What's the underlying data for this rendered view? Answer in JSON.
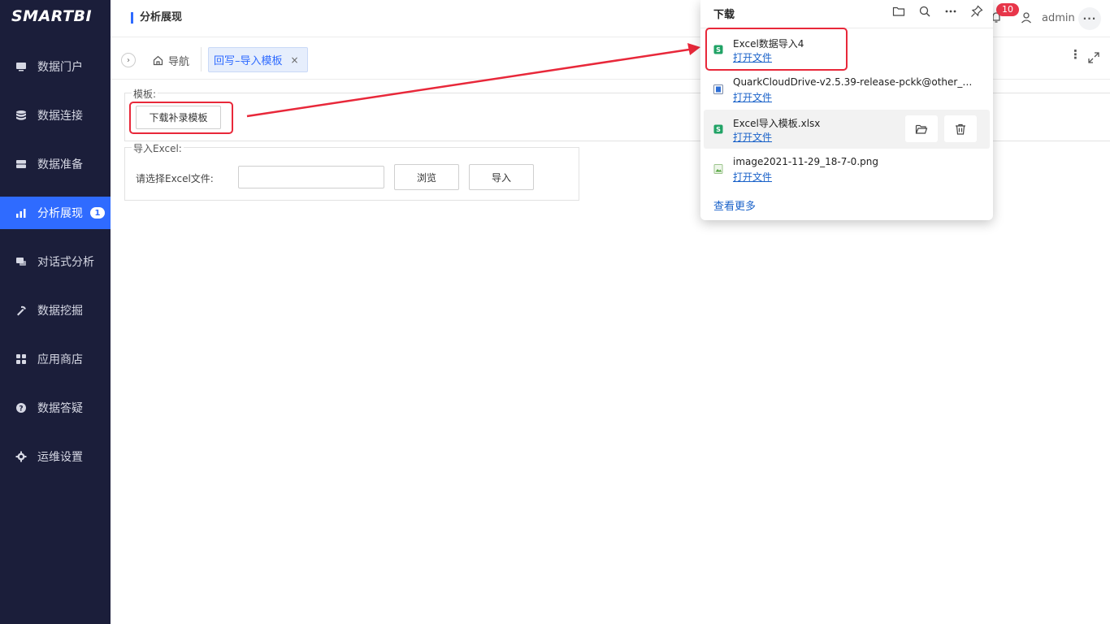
{
  "app": {
    "logo": "SMARTBI"
  },
  "sidebar": {
    "items": [
      {
        "label": "数据门户",
        "icon": "monitor-icon"
      },
      {
        "label": "数据连接",
        "icon": "database-icon"
      },
      {
        "label": "数据准备",
        "icon": "server-icon"
      },
      {
        "label": "分析展现",
        "icon": "bar-chart-icon",
        "badge": "1",
        "active": true
      },
      {
        "label": "对话式分析",
        "icon": "chat-icon"
      },
      {
        "label": "数据挖掘",
        "icon": "pickaxe-icon"
      },
      {
        "label": "应用商店",
        "icon": "grid-icon"
      },
      {
        "label": "数据答疑",
        "icon": "question-icon"
      },
      {
        "label": "运维设置",
        "icon": "gear-icon"
      }
    ]
  },
  "header": {
    "title": "分析展现",
    "notification_count": "10",
    "username": "admin",
    "more": "···"
  },
  "tabs": {
    "collapse": "›",
    "home_label": "导航",
    "active_label": "回写–导入模板",
    "close": "×",
    "dots": "⋮"
  },
  "template_section": {
    "legend": "模板:",
    "download_button": "下载补录模板"
  },
  "import_section": {
    "legend": "导入Excel:",
    "file_label": "请选择Excel文件:",
    "file_value": "",
    "browse_button": "浏览",
    "import_button": "导入"
  },
  "downloads": {
    "title": "下载",
    "items": [
      {
        "name": "Excel数据导入4",
        "action": "打开文件",
        "icon": "excel-file-icon"
      },
      {
        "name": "QuarkCloudDrive-v2.5.39-release-pckk@other_ch-...",
        "action": "打开文件",
        "icon": "installer-file-icon"
      },
      {
        "name": "Excel导入模板.xlsx",
        "action": "打开文件",
        "icon": "excel-file-icon"
      },
      {
        "name": "image2021-11-29_18-7-0.png",
        "action": "打开文件",
        "icon": "image-file-icon"
      }
    ],
    "see_more": "查看更多"
  },
  "colors": {
    "sidebar_bg": "#1b1e3a",
    "accent": "#2f6bff",
    "annotation_red": "#e8283a",
    "badge_red": "#e8364a",
    "link_blue": "#1a62c9"
  }
}
